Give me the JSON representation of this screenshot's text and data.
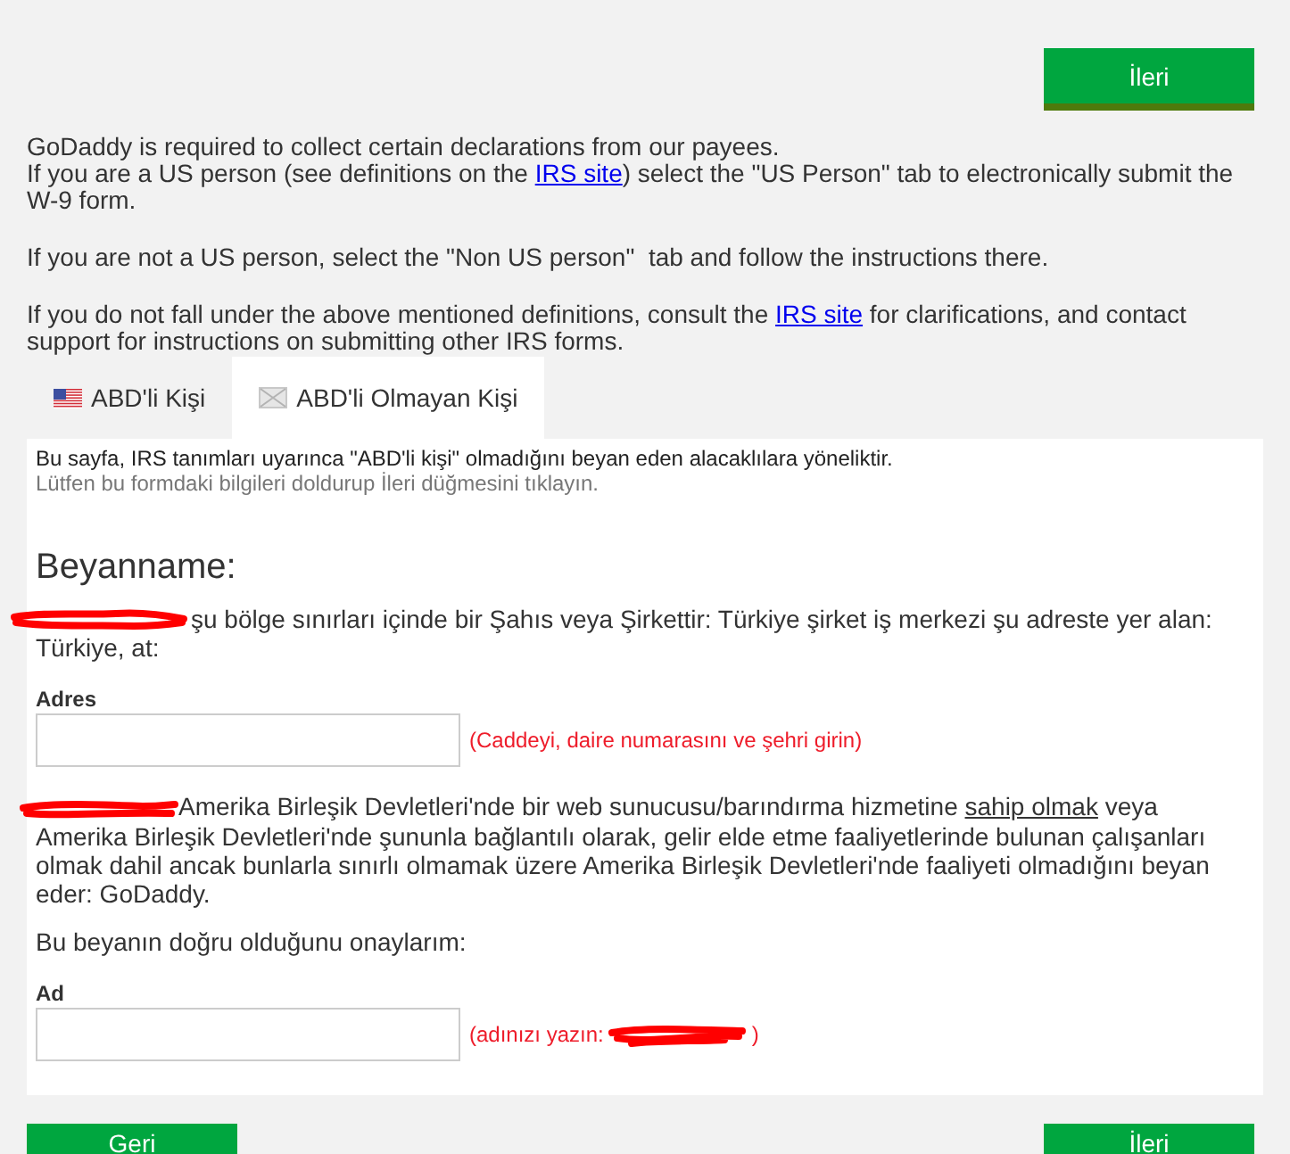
{
  "header": {
    "next_button": "İleri"
  },
  "intro": [
    {
      "sentences": [
        {
          "parts": [
            {
              "kind": "text",
              "text": "GoDaddy is required to collect certain declarations from our payees."
            }
          ]
        },
        {
          "parts": [
            {
              "kind": "text",
              "text": "If you are a US person (see definitions on the "
            },
            {
              "kind": "link",
              "text": "IRS site"
            },
            {
              "kind": "text",
              "text": ") select the \"US Person\" tab to electronically submit the W-9 form."
            }
          ]
        }
      ]
    },
    {
      "sentences": [
        {
          "parts": [
            {
              "kind": "text",
              "text": "If you are not a US person, select the \"Non US person\"  tab and follow the instructions there."
            }
          ]
        }
      ]
    },
    {
      "sentences": [
        {
          "parts": [
            {
              "kind": "text",
              "text": "If you do not fall under the above mentioned definitions, consult the "
            },
            {
              "kind": "link",
              "text": "IRS site"
            },
            {
              "kind": "text",
              "text": " for clarifications, and contact support for instructions on submitting other IRS forms."
            }
          ]
        }
      ]
    }
  ],
  "tabs": [
    {
      "kind": "us_person",
      "label": "ABD'li Kişi",
      "selected": false
    },
    {
      "kind": "non_us_person",
      "label": "ABD'li Olmayan Kişi",
      "selected": true
    }
  ],
  "panel": {
    "notice": "Bu sayfa, IRS tanımları uyarınca \"ABD'li kişi\" olmadığını beyan eden alacaklılara yöneliktir.",
    "instruction": "Lütfen bu formdaki bilgileri doldurup İleri düğmesini tıklayın.",
    "heading": "Beyanname:",
    "declaration": {
      "redacted": true,
      "parts": [
        {
          "kind": "text",
          "text": "şu bölge sınırları içinde bir Şahıs veya Şirkettir: Türkiye şirket iş merkezi şu adreste yer alan: Türkiye, at:"
        }
      ]
    },
    "address_field": {
      "label": "Adres",
      "hint": "(Caddeyi, daire numarasını ve şehri girin)"
    },
    "statement": {
      "redacted": true,
      "parts": [
        {
          "kind": "text",
          "text": "Amerika Birleşik Devletleri'nde bir web sunucusu/barındırma hizmetine "
        },
        {
          "kind": "term",
          "text": "sahip olmak"
        },
        {
          "kind": "text",
          "text": " veya Amerika Birleşik Devletleri'nde şununla bağlantılı olarak, gelir elde etme faaliyetlerinde bulunan çalışanları olmak dahil ancak bunlarla sınırlı olmamak üzere Amerika Birleşik Devletleri'nde faaliyeti olmadığını beyan eder: GoDaddy."
        }
      ]
    },
    "confirmation": "Bu beyanın doğru olduğunu onaylarım:",
    "name_field": {
      "label": "Ad",
      "hint": "(adınızı yazın:",
      "redacted": true,
      "hint_end": ")"
    }
  },
  "footer": {
    "back_button": "Geri",
    "next_button": "İleri"
  }
}
